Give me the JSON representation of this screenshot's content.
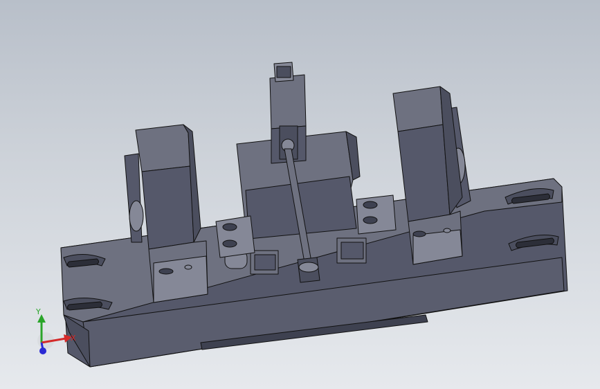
{
  "triad": {
    "x_label": "X",
    "y_label": "Y",
    "x_color": "#d42a2a",
    "y_color": "#2aa52a",
    "z_color": "#2a2ad4"
  },
  "colors": {
    "part_face": "#6e7180",
    "part_dark": "#55586a",
    "part_light": "#858897",
    "edge": "#111111"
  }
}
